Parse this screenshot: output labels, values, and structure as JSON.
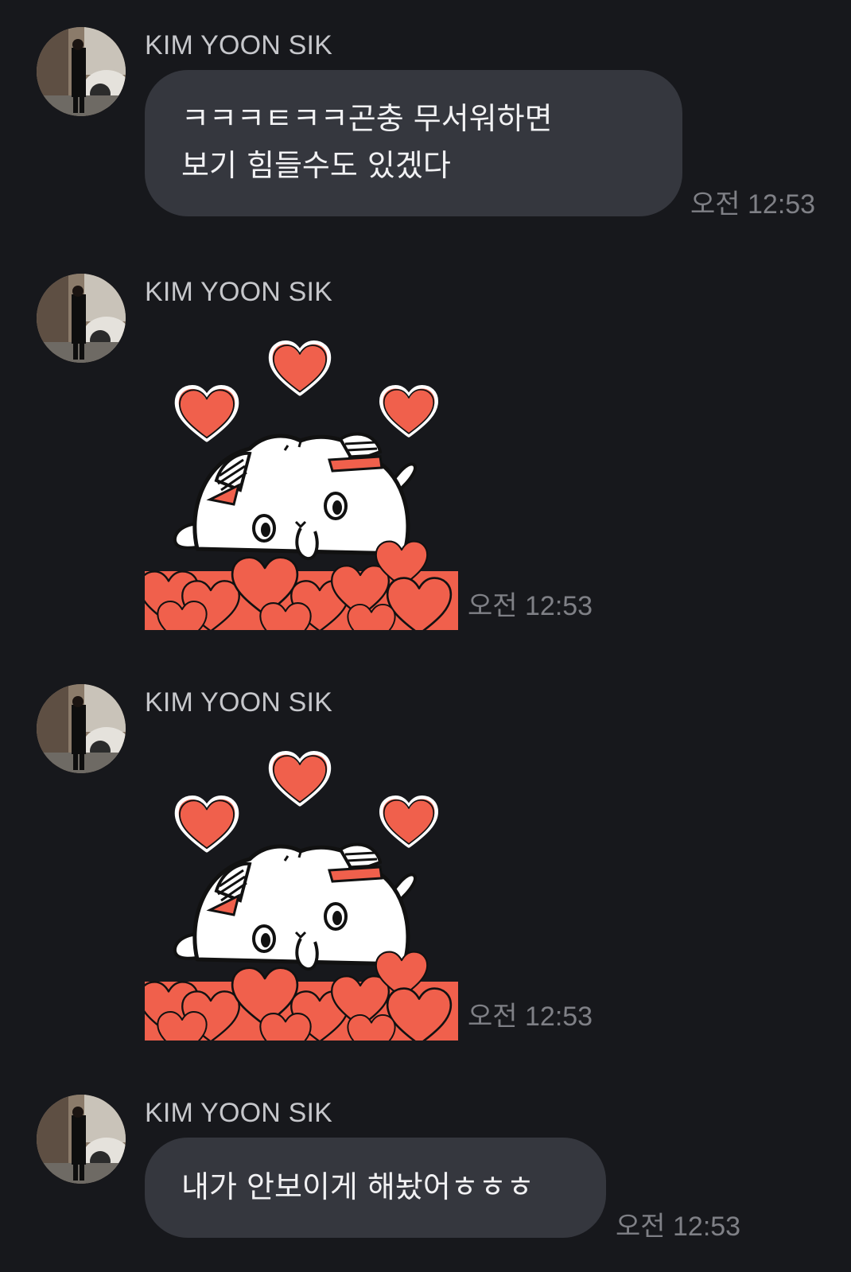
{
  "messages": [
    {
      "type": "text",
      "sender": "KIM YOON SIK",
      "text": "ㅋㅋㅋㅌㅋㅋ곤충 무서워하면\n보기 힘들수도 있겠다",
      "time": "오전 12:53"
    },
    {
      "type": "sticker",
      "sender": "KIM YOON SIK",
      "sticker": "white-cat-hearts-sticker",
      "time": "오전 12:53"
    },
    {
      "type": "sticker",
      "sender": "KIM YOON SIK",
      "sticker": "white-cat-hearts-sticker",
      "time": "오전 12:53"
    },
    {
      "type": "text",
      "sender": "KIM YOON SIK",
      "text": "내가 안보이게 해놨어ㅎㅎㅎ",
      "time": "오전 12:53"
    }
  ],
  "colors": {
    "background": "#17181c",
    "bubble": "#35373e",
    "heart": "#f0604c",
    "timestamp": "#7f8086"
  }
}
